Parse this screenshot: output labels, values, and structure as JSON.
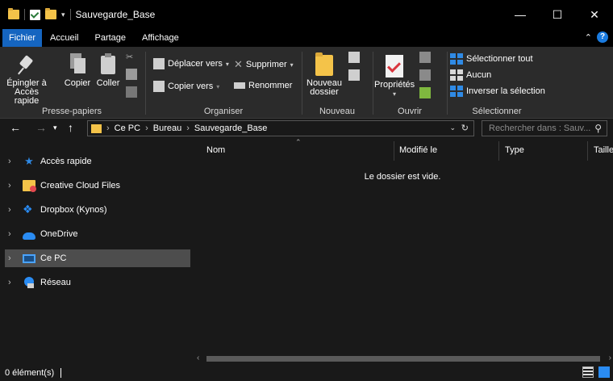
{
  "window": {
    "title": "Sauvegarde_Base",
    "quick_access_dropdown": "▾",
    "minimize": "—",
    "maximize": "☐",
    "close": "✕"
  },
  "tabs": [
    {
      "label": "Fichier",
      "active": true
    },
    {
      "label": "Accueil"
    },
    {
      "label": "Partage"
    },
    {
      "label": "Affichage"
    }
  ],
  "ribbon": {
    "clipboard": {
      "label": "Presse-papiers",
      "pin_line1": "Épingler à",
      "pin_line2": "Accès rapide",
      "copy": "Copier",
      "paste": "Coller"
    },
    "organize": {
      "label": "Organiser",
      "move_to": "Déplacer vers",
      "copy_to": "Copier vers",
      "delete": "Supprimer",
      "rename": "Renommer"
    },
    "new": {
      "label": "Nouveau",
      "new_folder_line1": "Nouveau",
      "new_folder_line2": "dossier"
    },
    "open": {
      "label": "Ouvrir",
      "properties": "Propriétés"
    },
    "select": {
      "label": "Sélectionner",
      "select_all": "Sélectionner tout",
      "select_none": "Aucun",
      "invert": "Inverser la sélection"
    }
  },
  "address": {
    "crumbs": [
      "Ce PC",
      "Bureau",
      "Sauvegarde_Base"
    ],
    "search_placeholder": "Rechercher dans : Sauv..."
  },
  "nav_pane": [
    {
      "label": "Accès rapide",
      "icon": "star-icon"
    },
    {
      "label": "Creative Cloud Files",
      "icon": "creative-cloud-folder-icon"
    },
    {
      "label": "Dropbox (Kynos)",
      "icon": "dropbox-icon"
    },
    {
      "label": "OneDrive",
      "icon": "onedrive-cloud-icon"
    },
    {
      "label": "Ce PC",
      "icon": "computer-icon",
      "selected": true
    },
    {
      "label": "Réseau",
      "icon": "network-icon"
    }
  ],
  "columns": [
    "Nom",
    "Modifié le",
    "Type",
    "Taille"
  ],
  "empty_message": "Le dossier est vide.",
  "status": {
    "item_count": "0 élément(s)"
  },
  "colors": {
    "accent": "#1565c0",
    "background": "#191919",
    "ribbon_bg": "#2b2b2b",
    "selected_item": "#4d4d4d"
  }
}
